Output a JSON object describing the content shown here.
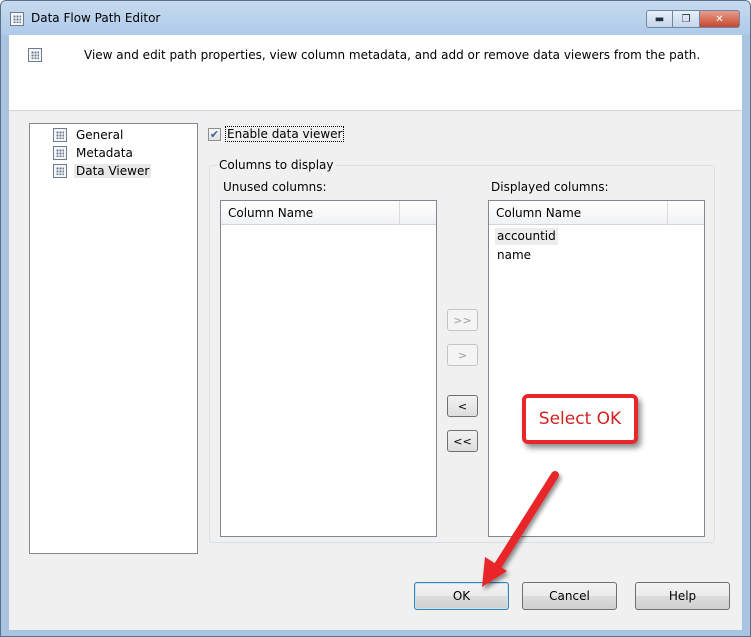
{
  "window": {
    "title": "Data Flow Path Editor",
    "controls": {
      "minimize": "▬",
      "maximize": "❐",
      "close": "✕"
    }
  },
  "banner": {
    "text": "View and edit path properties, view column metadata, and add or remove data viewers from the path."
  },
  "nav": {
    "items": [
      {
        "label": "General",
        "selected": false
      },
      {
        "label": "Metadata",
        "selected": false
      },
      {
        "label": "Data Viewer",
        "selected": true
      }
    ]
  },
  "viewer": {
    "enable_label": "Enable data viewer",
    "enabled": true,
    "check_glyph": "✔",
    "group_label": "Columns to display",
    "unused": {
      "caption": "Unused columns:",
      "header": "Column Name",
      "rows": []
    },
    "displayed": {
      "caption": "Displayed columns:",
      "header": "Column Name",
      "rows": [
        "accountid",
        "name"
      ]
    },
    "buttons": {
      "add_all": ">>",
      "add": ">",
      "remove": "<",
      "remove_all": "<<"
    }
  },
  "footer": {
    "ok": "OK",
    "cancel": "Cancel",
    "help": "Help"
  },
  "annotation": {
    "text": "Select OK",
    "color": "#e8272a"
  }
}
